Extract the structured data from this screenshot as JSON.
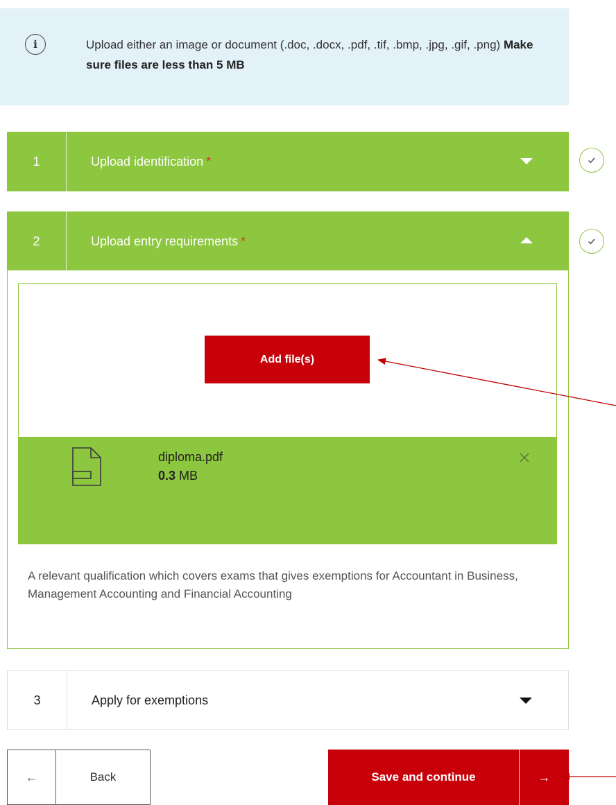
{
  "info": {
    "text": "Upload either an image or document (.doc, .docx, .pdf, .tif, .bmp, .jpg, .gif, .png)",
    "bold_text": "Make sure files are less than 5 MB",
    "icon": "info-icon"
  },
  "steps": [
    {
      "number": "1",
      "title": "Upload identification",
      "required_mark": "*",
      "expanded": false,
      "completed": true
    },
    {
      "number": "2",
      "title": "Upload entry requirements",
      "required_mark": "*",
      "expanded": true,
      "completed": true
    },
    {
      "number": "3",
      "title": "Apply for exemptions",
      "expanded": false
    }
  ],
  "upload": {
    "add_button_label": "Add file(s)",
    "file": {
      "name": "diploma.pdf",
      "size_value": "0.3",
      "size_unit": "MB",
      "icon": "file-icon"
    },
    "remove_icon": "close-icon",
    "description": "A relevant qualification which covers exams that gives exemptions for Accountant in Business, Management Accounting and Financial Accounting"
  },
  "footer": {
    "back_arrow": "←",
    "back_label": "Back",
    "save_label": "Save and continue",
    "save_arrow": "→"
  },
  "colors": {
    "accent_green": "#8dc63f",
    "primary_red": "#c8000a",
    "info_bg": "#e3f1f8",
    "required_mark": "#d04027",
    "annotation_arrow": "#c00000"
  }
}
